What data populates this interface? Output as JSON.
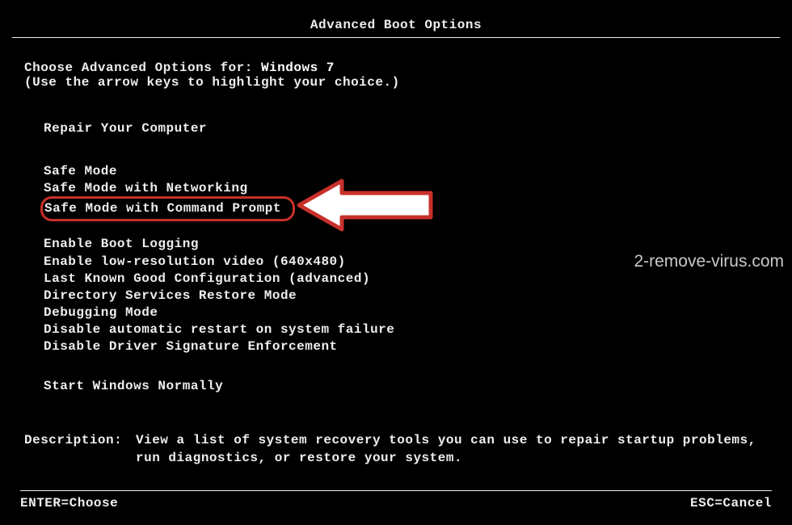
{
  "title": "Advanced Boot Options",
  "choose_prefix": "Choose Advanced Options for: ",
  "os_name": "Windows 7",
  "use_arrows": "(Use the arrow keys to highlight your choice.)",
  "repair": "Repair Your Computer",
  "safe_modes": {
    "safe": "Safe Mode",
    "net": "Safe Mode with Networking",
    "cmd": "Safe Mode with Command Prompt"
  },
  "options": {
    "bootlog": "Enable Boot Logging",
    "lowres": "Enable low-resolution video (640x480)",
    "lkgc": "Last Known Good Configuration (advanced)",
    "dsrm": "Directory Services Restore Mode",
    "debug": "Debugging Mode",
    "noauto": "Disable automatic restart on system failure",
    "dse": "Disable Driver Signature Enforcement"
  },
  "normal": "Start Windows Normally",
  "desc_label": "Description:",
  "desc_text": "View a list of system recovery tools you can use to repair startup problems, run diagnostics, or restore your system.",
  "footer": {
    "enter": "ENTER=Choose",
    "esc": "ESC=Cancel"
  },
  "watermark": "2-remove-virus.com"
}
